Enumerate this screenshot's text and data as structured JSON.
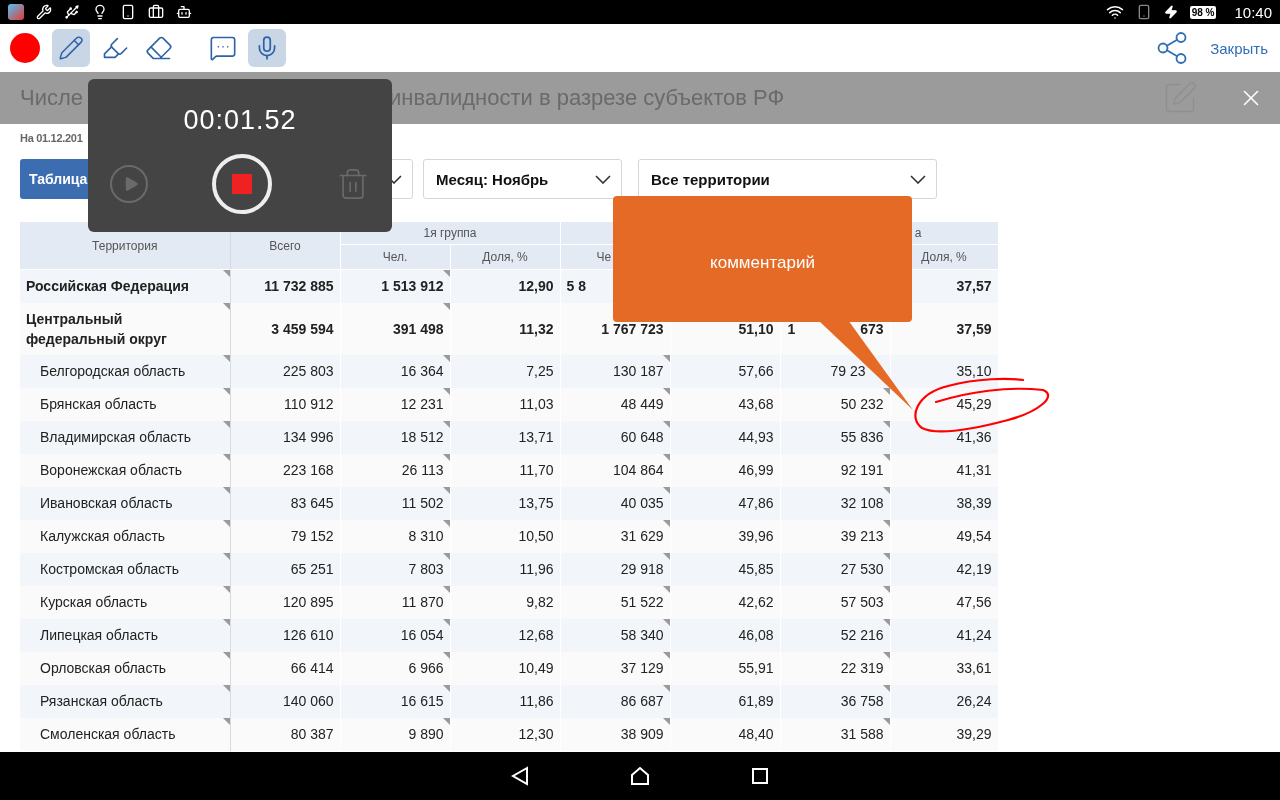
{
  "status_bar": {
    "battery": "98 %",
    "time": "10:40"
  },
  "toolbar": {
    "tools": [
      {
        "kind": "pencil",
        "selected": true
      },
      {
        "kind": "highlighter",
        "selected": false
      },
      {
        "kind": "eraser",
        "selected": false
      },
      {
        "kind": "comment",
        "selected": false
      },
      {
        "kind": "microphone",
        "selected": true
      }
    ],
    "close_label": "Закрыть"
  },
  "title": {
    "parts": [
      "Числе",
      "инвалидности в разрезе субъектов РФ"
    ]
  },
  "date": "На 01.12.201",
  "filters": {
    "view_button": "Таблица",
    "dropdowns": [
      {
        "expanded": false
      },
      {
        "label": "Месяц: Ноябрь",
        "expanded": false
      },
      {
        "label": "Все территории",
        "expanded": false
      }
    ]
  },
  "recorder": {
    "time": "00:01.52",
    "play_disabled": true,
    "delete_disabled": true
  },
  "callout": {
    "text": "комментарий"
  },
  "table": {
    "columns": [
      {
        "label": "Территория"
      },
      {
        "label": "Всего"
      }
    ],
    "groups": [
      {
        "label": "1я группа",
        "subcolumns": [
          {
            "label": "Чел."
          },
          {
            "label": "Доля, %"
          }
        ]
      },
      {
        "subcolumns": [
          {
            "label": "Че",
            "cut_end": true
          },
          {}
        ]
      },
      {
        "label": "а",
        "cut_start": true,
        "subcolumns": [
          {},
          {
            "label": "Доля, %"
          }
        ]
      }
    ],
    "rows": [
      {
        "kind": "total",
        "cells": [
          "Российская Федерация",
          "11 732 885",
          "1 513 912",
          "12,90",
          {
            "text": "5 8",
            "cut_end": true
          },
          null,
          null,
          "37,57"
        ]
      },
      {
        "kind": "total",
        "cells": [
          "Центральный федеральный округ",
          "3 459 594",
          "391 498",
          "11,32",
          "1 767 723",
          "51,10",
          {
            "parts": [
              "1",
              "673"
            ]
          },
          "37,59"
        ]
      },
      {
        "kind": "region",
        "cells": [
          "Белгородская область",
          "225 803",
          "16 364",
          "7,25",
          "130 187",
          "57,66",
          {
            "text": "79 23",
            "cut_end": true
          },
          "35,10"
        ]
      },
      {
        "kind": "region",
        "cells": [
          "Брянская область",
          "110 912",
          "12 231",
          "11,03",
          "48 449",
          "43,68",
          "50 232",
          "45,29"
        ]
      },
      {
        "kind": "region",
        "cells": [
          "Владимирская область",
          "134 996",
          "18 512",
          "13,71",
          "60 648",
          "44,93",
          "55 836",
          "41,36"
        ]
      },
      {
        "kind": "region",
        "cells": [
          "Воронежская область",
          "223 168",
          "26 113",
          "11,70",
          "104 864",
          "46,99",
          "92 191",
          "41,31"
        ]
      },
      {
        "kind": "region",
        "cells": [
          "Ивановская область",
          "83 645",
          "11 502",
          "13,75",
          "40 035",
          "47,86",
          "32 108",
          "38,39"
        ]
      },
      {
        "kind": "region",
        "cells": [
          "Калужская область",
          "79 152",
          "8 310",
          "10,50",
          "31 629",
          "39,96",
          "39 213",
          "49,54"
        ]
      },
      {
        "kind": "region",
        "cells": [
          "Костромская область",
          "65 251",
          "7 803",
          "11,96",
          "29 918",
          "45,85",
          "27 530",
          "42,19"
        ]
      },
      {
        "kind": "region",
        "cells": [
          "Курская область",
          "120 895",
          "11 870",
          "9,82",
          "51 522",
          "42,62",
          "57 503",
          "47,56"
        ]
      },
      {
        "kind": "region",
        "cells": [
          "Липецкая область",
          "126 610",
          "16 054",
          "12,68",
          "58 340",
          "46,08",
          "52 216",
          "41,24"
        ]
      },
      {
        "kind": "region",
        "cells": [
          "Орловская область",
          "66 414",
          "6 966",
          "10,49",
          "37 129",
          "55,91",
          "22 319",
          "33,61"
        ]
      },
      {
        "kind": "region",
        "cells": [
          "Рязанская область",
          "140 060",
          "16 615",
          "11,86",
          "86 687",
          "61,89",
          "36 758",
          "26,24"
        ]
      },
      {
        "kind": "region",
        "cells": [
          "Смоленская область",
          "80 387",
          "9 890",
          "12,30",
          "38 909",
          "48,40",
          "31 588",
          "39,29"
        ]
      }
    ]
  }
}
